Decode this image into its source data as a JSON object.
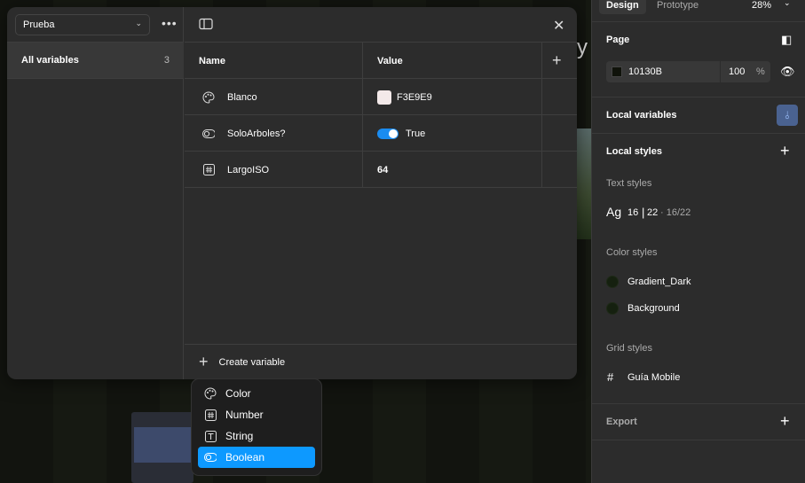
{
  "modal": {
    "collection": "Prueba",
    "sidebar": {
      "label": "All variables",
      "count": "3"
    },
    "columns": {
      "name": "Name",
      "value": "Value"
    },
    "rows": [
      {
        "type": "color",
        "name": "Blanco",
        "value": "F3E9E9",
        "swatch": "#F3E9E9"
      },
      {
        "type": "boolean",
        "name": "SoloArboles?",
        "value": "True"
      },
      {
        "type": "number",
        "name": "LargoISO",
        "value": "64"
      }
    ],
    "create_label": "Create variable"
  },
  "menu": {
    "items": [
      {
        "label": "Color",
        "icon": "palette-icon"
      },
      {
        "label": "Number",
        "icon": "hash-icon"
      },
      {
        "label": "String",
        "icon": "text-icon"
      },
      {
        "label": "Boolean",
        "icon": "toggle-icon"
      }
    ],
    "selected": "Boolean"
  },
  "panel": {
    "tabs": {
      "design": "Design",
      "prototype": "Prototype"
    },
    "zoom": "28%",
    "page": {
      "title": "Page",
      "color": "10130B",
      "opacity": "100",
      "pct": "%"
    },
    "local_variables": "Local variables",
    "local_styles": "Local styles",
    "text_styles": {
      "title": "Text styles",
      "ag": "Ag",
      "size": "16",
      "line": "22",
      "combo": "· 16/22"
    },
    "color_styles": {
      "title": "Color styles",
      "items": [
        "Gradient_Dark",
        "Background"
      ]
    },
    "grid_styles": {
      "title": "Grid styles",
      "items": [
        "Guía Mobile"
      ]
    },
    "export": "Export"
  },
  "accent": "#0d99ff"
}
